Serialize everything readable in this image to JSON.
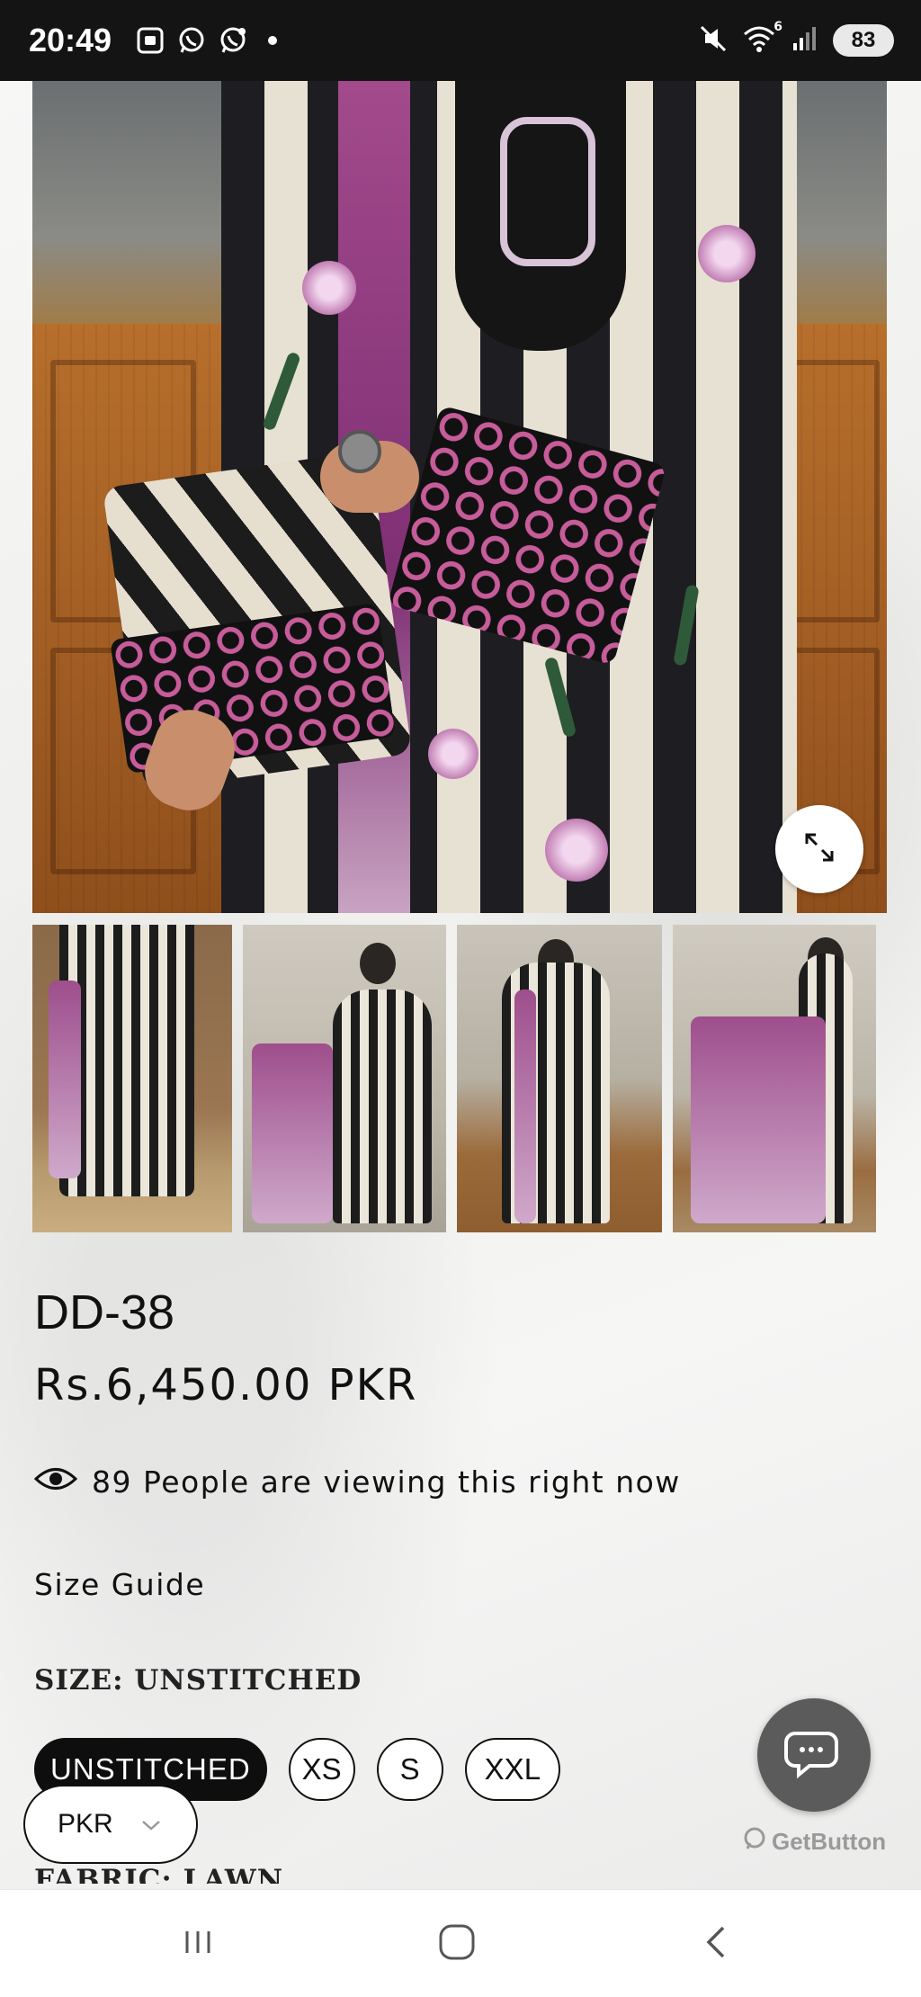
{
  "status_bar": {
    "time": "20:49",
    "battery": "83",
    "left_icons": [
      "screenshot-icon",
      "whatsapp-icon",
      "whatsapp-business-icon",
      "dot-icon"
    ],
    "right_icons": [
      "mute-icon",
      "wifi-icon",
      "signal-icon"
    ],
    "wifi_badge": "6"
  },
  "product": {
    "title": "DD-38",
    "price": "Rs.6,450.00 PKR",
    "viewing_text": "89 People are viewing this right now",
    "size_guide_label": "Size Guide",
    "size_label": "SIZE: UNSTITCHED",
    "fabric_label": "FABRIC: LAWN",
    "size_options": [
      {
        "label": "UNSTITCHED",
        "selected": true
      },
      {
        "label": "XS",
        "selected": false
      },
      {
        "label": "S",
        "selected": false
      },
      {
        "label": "XXL",
        "selected": false
      }
    ]
  },
  "gallery": {
    "thumbnail_count": 4
  },
  "currency_selector": {
    "value": "PKR"
  },
  "chat_widget": {
    "brand_label": "GetButton"
  },
  "colors": {
    "status_bar_bg": "#141414",
    "selected_size_bg": "#0e0e0e",
    "chat_button_bg": "#5b5b5b",
    "accent_purple": "#a24a8c"
  }
}
